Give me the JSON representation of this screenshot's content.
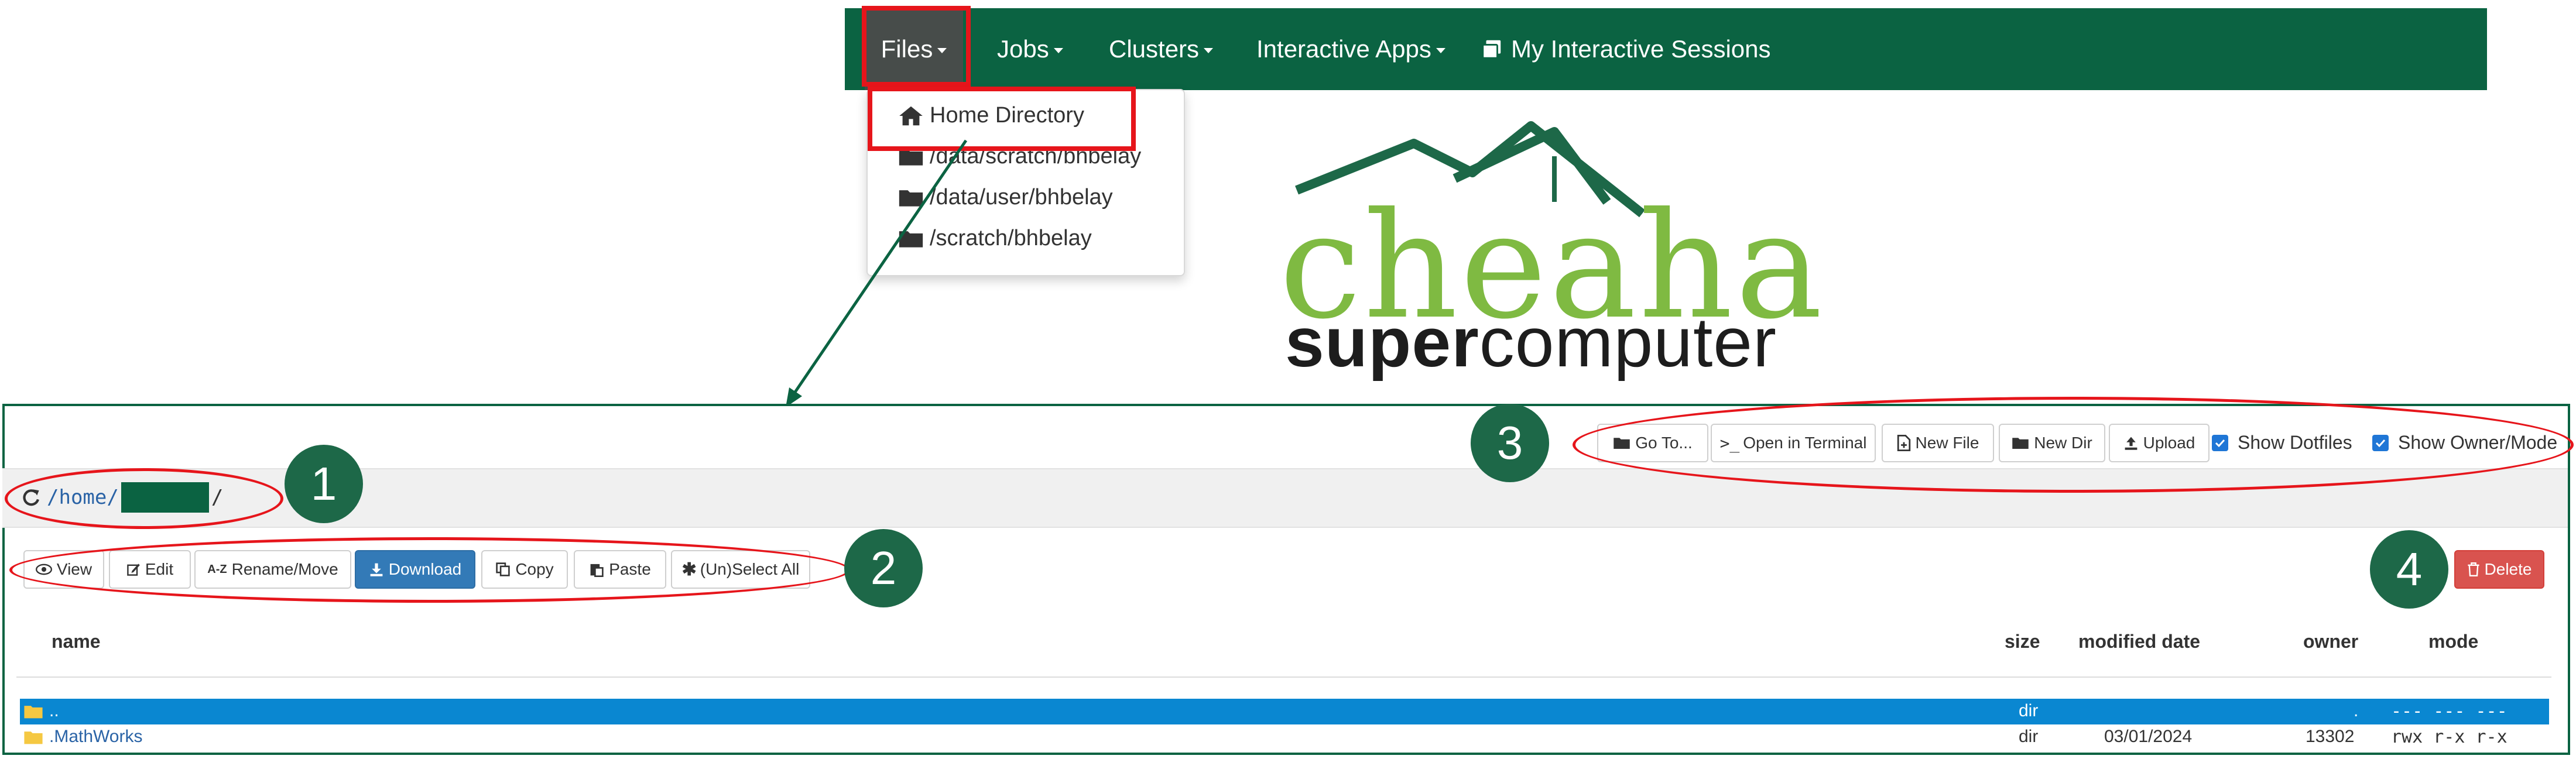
{
  "navbar": {
    "files_label": "Files",
    "jobs_label": "Jobs",
    "clusters_label": "Clusters",
    "apps_label": "Interactive Apps",
    "sessions_label": "My Interactive Sessions"
  },
  "files_menu": {
    "items": [
      {
        "label": "Home Directory",
        "icon": "home-icon"
      },
      {
        "label": "/data/scratch/bhbelay",
        "icon": "folder-icon"
      },
      {
        "label": "/data/user/bhbelay",
        "icon": "folder-icon"
      },
      {
        "label": "/scratch/bhbelay",
        "icon": "folder-icon"
      }
    ]
  },
  "logo": {
    "name": "cheaha",
    "subtitle_bold": "super",
    "subtitle_rest": "computer"
  },
  "toolbar_top": {
    "goto": "Go To...",
    "terminal": "Open in Terminal",
    "new_file": "New File",
    "new_dir": "New Dir",
    "upload": "Upload",
    "show_dotfiles": "Show Dotfiles",
    "show_owner_mode": "Show Owner/Mode"
  },
  "path": {
    "prefix": "/home/",
    "suffix": "/"
  },
  "toolbar_actions": {
    "view": "View",
    "edit": "Edit",
    "rename": "Rename/Move",
    "download": "Download",
    "copy": "Copy",
    "paste": "Paste",
    "select_all": "(Un)Select All",
    "delete": "Delete"
  },
  "table": {
    "headers": {
      "name": "name",
      "size": "size",
      "modified": "modified date",
      "owner": "owner",
      "mode": "mode"
    },
    "rows": [
      {
        "name": "..",
        "size": "dir",
        "modified": "",
        "owner": ".",
        "mode": "--- --- ---",
        "selected": true
      },
      {
        "name": ".MathWorks",
        "size": "dir",
        "modified": "03/01/2024",
        "owner": "13302",
        "mode": "rwx r-x r-x",
        "selected": false
      }
    ]
  },
  "annotations": {
    "m1": "1",
    "m2": "2",
    "m3": "3",
    "m4": "4"
  },
  "colors": {
    "brand_green": "#0b6342",
    "highlight_red": "#e6151b",
    "logo_green": "#7fba42",
    "selected_row": "#0a87d1"
  }
}
